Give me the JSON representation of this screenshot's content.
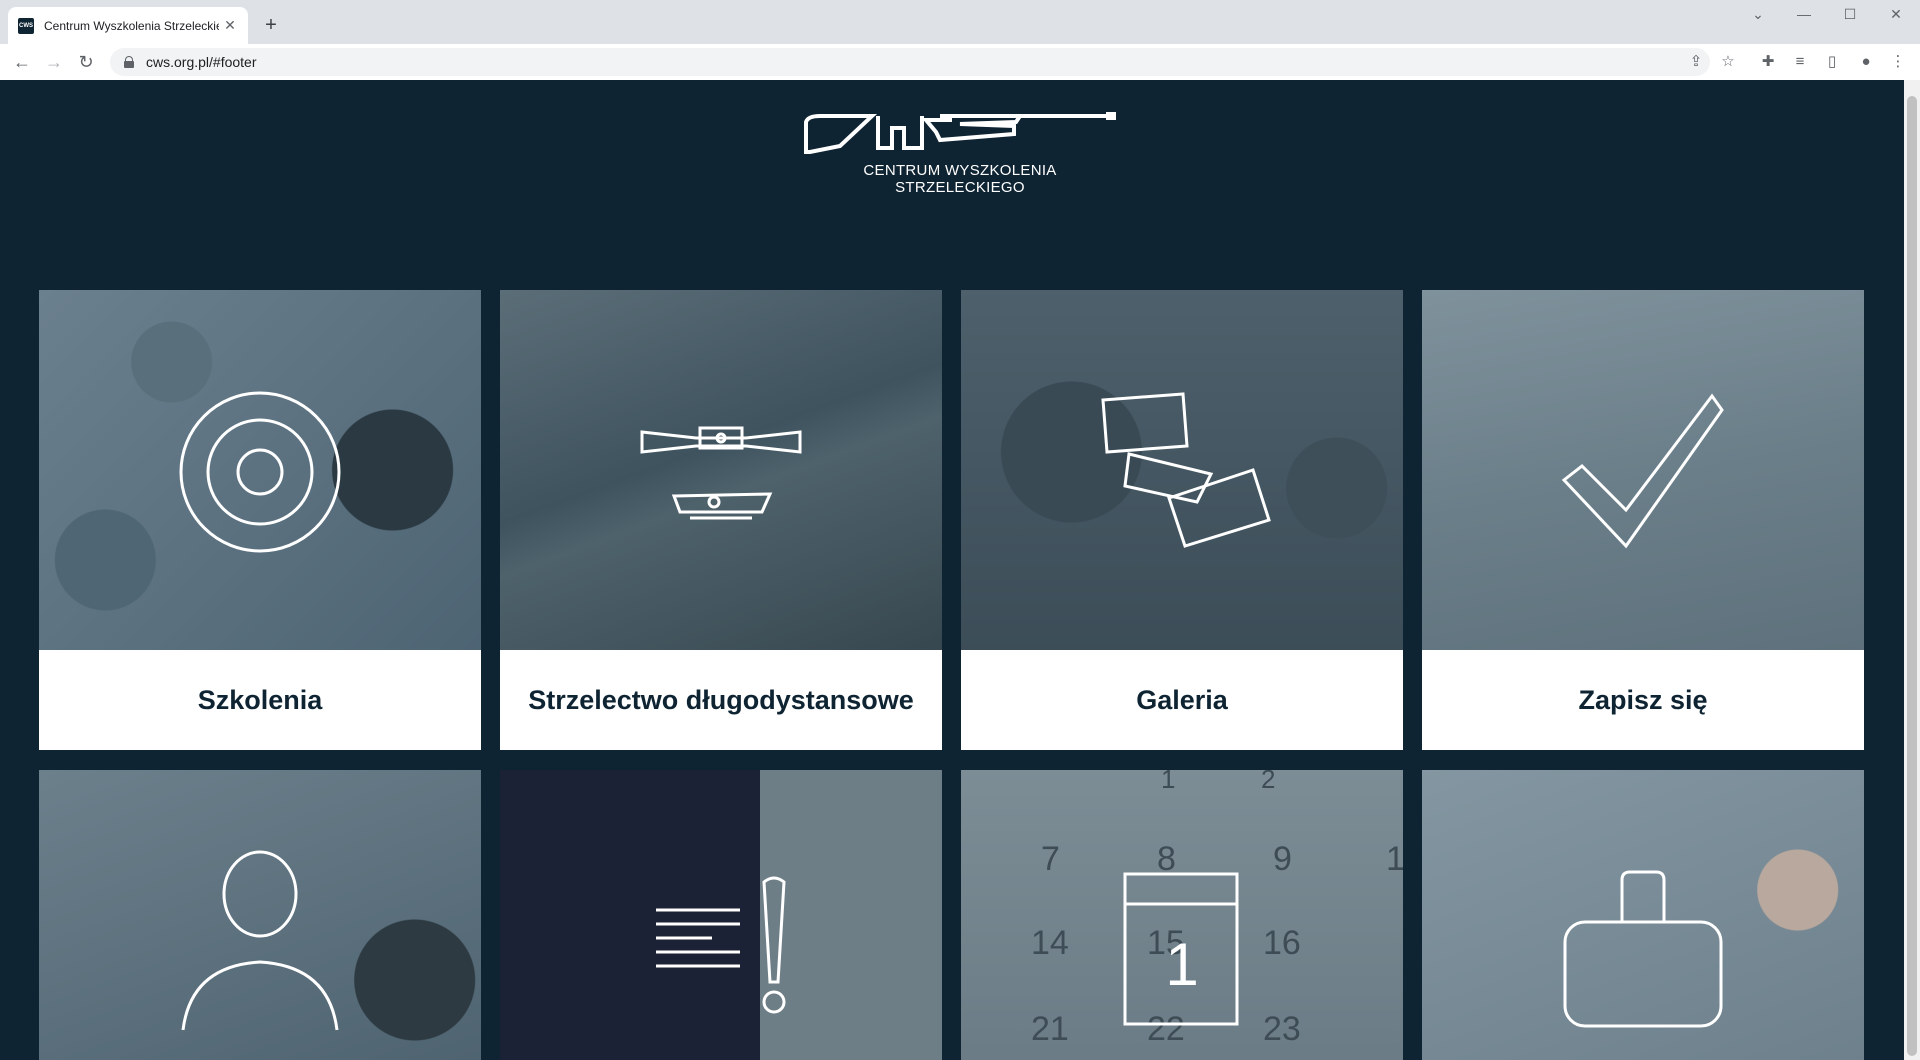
{
  "browser": {
    "tab_title": "Centrum Wyszkolenia Strzeleckie",
    "favicon_text": "CWS",
    "url": "cws.org.pl/#footer"
  },
  "header": {
    "logo_text": "CWS",
    "subtitle": "CENTRUM WYSZKOLENIA STRZELECKIEGO"
  },
  "tiles": [
    {
      "label": "Szkolenia",
      "icon": "target-icon"
    },
    {
      "label": "Strzelectwo długodystansowe",
      "icon": "rifle-scope-icon"
    },
    {
      "label": "Galeria",
      "icon": "photos-icon"
    },
    {
      "label": "Zapisz się",
      "icon": "checkmark-icon"
    }
  ],
  "tiles_row2": [
    {
      "icon": "person-icon",
      "label": ""
    },
    {
      "icon": "notice-icon",
      "label": ""
    },
    {
      "icon": "calendar-icon",
      "label": "",
      "calendar_numbers": [
        "7",
        "8",
        "9",
        "14",
        "15",
        "16",
        "21",
        "22",
        "23",
        "1",
        "2",
        "1"
      ],
      "calendar_day": "1"
    },
    {
      "icon": "bag-icon",
      "label": ""
    }
  ],
  "colors": {
    "page_bg": "#0f2433",
    "tile_overlay": "#2d4a5e",
    "label_text": "#0f2433"
  }
}
